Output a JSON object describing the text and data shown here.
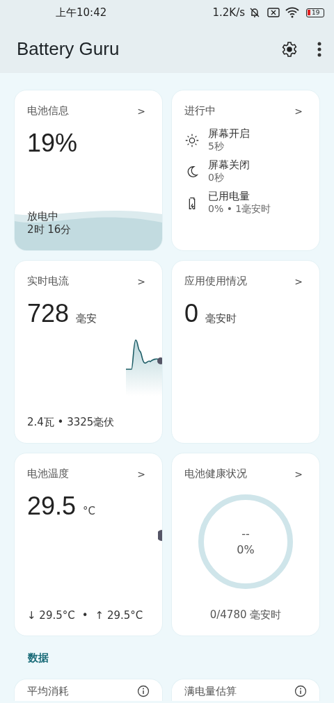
{
  "status_bar": {
    "time": "上午10:42",
    "network_speed": "1.2K/s",
    "battery_level": "19"
  },
  "app_bar": {
    "title": "Battery Guru"
  },
  "cards": [
    {
      "kind": "battery",
      "title": "电池信息",
      "chevron": ">",
      "value": "19%",
      "status": "放电中",
      "remaining": "2时 16分"
    },
    {
      "kind": "ongoing",
      "title": "进行中",
      "chevron": ">",
      "items": [
        {
          "kind": "screen_on",
          "label": "屏幕开启",
          "value": "5秒"
        },
        {
          "kind": "screen_off",
          "label": "屏幕关闭",
          "value": "0秒"
        },
        {
          "kind": "used_charge",
          "label": "已用电量",
          "value": "0% • 1毫安时"
        }
      ]
    },
    {
      "kind": "current",
      "title": "实时电流",
      "chevron": ">",
      "value": "728",
      "unit": "毫安",
      "footer": "2.4瓦 • 3325毫伏"
    },
    {
      "kind": "usage",
      "title": "应用使用情况",
      "chevron": ">",
      "value": "0",
      "unit": "毫安时"
    },
    {
      "kind": "temperature",
      "title": "电池温度",
      "chevron": ">",
      "value": "29.5",
      "unit": "°C",
      "min": "↓ 29.5°C",
      "separator": "•",
      "max": "↑ 29.5°C"
    },
    {
      "kind": "health",
      "title": "电池健康状况",
      "chevron": ">",
      "gauge_top": "--",
      "gauge_value": "0%",
      "footer": "0/4780 毫安时"
    }
  ],
  "section_title": "数据",
  "bottom_cards": [
    {
      "title": "平均消耗"
    },
    {
      "title": "满电量估算"
    }
  ]
}
